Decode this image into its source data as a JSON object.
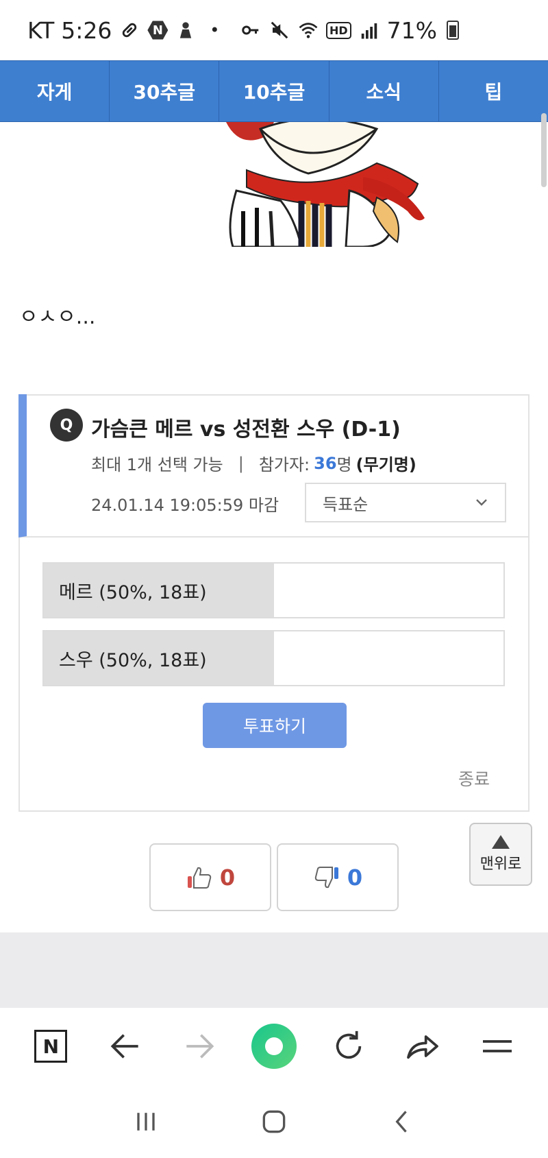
{
  "status_bar": {
    "carrier": "KT",
    "time": "5:26",
    "network_badge": "N",
    "battery_percent": "71%",
    "hd_badge": "HD"
  },
  "nav_tabs": [
    "자게",
    "30추글",
    "10추글",
    "소식",
    "팁"
  ],
  "post": {
    "body_text": "ㅇㅅㅇ..."
  },
  "poll": {
    "badge": "Q",
    "title": "가슴큰 메르 vs 성전환 스우 (D-1)",
    "max_select": "최대 1개 선택 가능",
    "separator": "|",
    "participants_label": "참가자:",
    "participants_count": "36",
    "participants_unit": "명",
    "anonymous": "(무기명)",
    "deadline": "24.01.14 19:05:59 마감",
    "sort_selected": "득표순",
    "options": [
      {
        "label": "메르 (50%, 18표)",
        "percent": 50
      },
      {
        "label": "스우 (50%, 18표)",
        "percent": 50
      }
    ],
    "vote_button": "투표하기",
    "end_label": "종료"
  },
  "top_button": {
    "label": "맨위로"
  },
  "rating": {
    "likes": "0",
    "dislikes": "0"
  },
  "browser_toolbar": {
    "items": [
      "naver-logo",
      "back",
      "forward",
      "home",
      "refresh",
      "share",
      "menu"
    ]
  },
  "colors": {
    "nav_blue": "#3f7fd0",
    "poll_accent": "#6f98e4",
    "count_blue": "#3b78d8",
    "like_red": "#c0463d"
  }
}
